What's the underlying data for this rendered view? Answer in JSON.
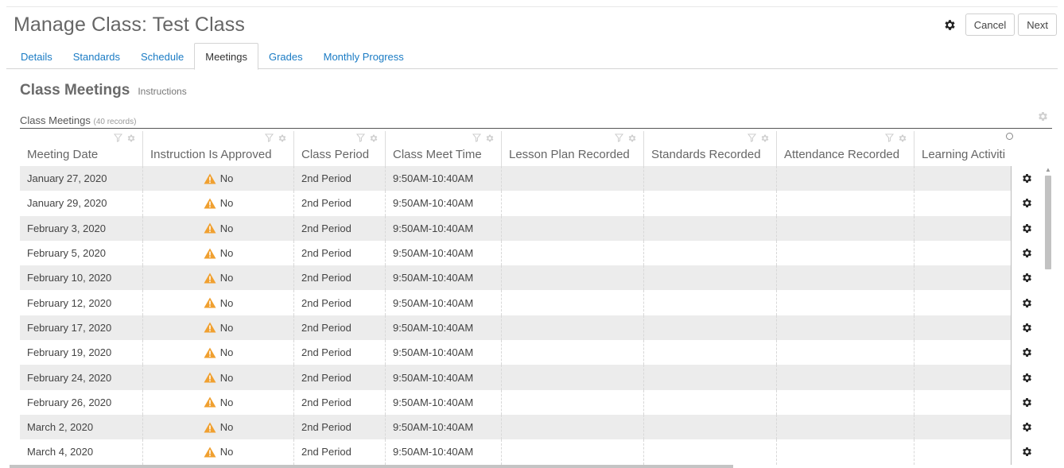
{
  "page_title": "Manage Class: Test Class",
  "actions": {
    "cancel_label": "Cancel",
    "next_label": "Next"
  },
  "tabs": [
    {
      "label": "Details",
      "active": false
    },
    {
      "label": "Standards",
      "active": false
    },
    {
      "label": "Schedule",
      "active": false
    },
    {
      "label": "Meetings",
      "active": true
    },
    {
      "label": "Grades",
      "active": false
    },
    {
      "label": "Monthly Progress",
      "active": false
    }
  ],
  "section": {
    "title": "Class Meetings",
    "instructions": "Instructions"
  },
  "grid": {
    "title": "Class Meetings",
    "count": "(40 records)",
    "columns": [
      {
        "label": "Meeting Date"
      },
      {
        "label": "Instruction Is Approved"
      },
      {
        "label": "Class Period"
      },
      {
        "label": "Class Meet Time"
      },
      {
        "label": "Lesson Plan Recorded"
      },
      {
        "label": "Standards Recorded"
      },
      {
        "label": "Attendance Recorded"
      },
      {
        "label": "Learning Activiti"
      }
    ],
    "rows": [
      {
        "date": "January 27, 2020",
        "approved": "No",
        "period": "2nd Period",
        "time": "9:50AM-10:40AM",
        "lesson": "",
        "standards": "",
        "attendance": "",
        "learning": ""
      },
      {
        "date": "January 29, 2020",
        "approved": "No",
        "period": "2nd Period",
        "time": "9:50AM-10:40AM",
        "lesson": "",
        "standards": "",
        "attendance": "",
        "learning": ""
      },
      {
        "date": "February 3, 2020",
        "approved": "No",
        "period": "2nd Period",
        "time": "9:50AM-10:40AM",
        "lesson": "",
        "standards": "",
        "attendance": "",
        "learning": ""
      },
      {
        "date": "February 5, 2020",
        "approved": "No",
        "period": "2nd Period",
        "time": "9:50AM-10:40AM",
        "lesson": "",
        "standards": "",
        "attendance": "",
        "learning": ""
      },
      {
        "date": "February 10, 2020",
        "approved": "No",
        "period": "2nd Period",
        "time": "9:50AM-10:40AM",
        "lesson": "",
        "standards": "",
        "attendance": "",
        "learning": ""
      },
      {
        "date": "February 12, 2020",
        "approved": "No",
        "period": "2nd Period",
        "time": "9:50AM-10:40AM",
        "lesson": "",
        "standards": "",
        "attendance": "",
        "learning": ""
      },
      {
        "date": "February 17, 2020",
        "approved": "No",
        "period": "2nd Period",
        "time": "9:50AM-10:40AM",
        "lesson": "",
        "standards": "",
        "attendance": "",
        "learning": ""
      },
      {
        "date": "February 19, 2020",
        "approved": "No",
        "period": "2nd Period",
        "time": "9:50AM-10:40AM",
        "lesson": "",
        "standards": "",
        "attendance": "",
        "learning": ""
      },
      {
        "date": "February 24, 2020",
        "approved": "No",
        "period": "2nd Period",
        "time": "9:50AM-10:40AM",
        "lesson": "",
        "standards": "",
        "attendance": "",
        "learning": ""
      },
      {
        "date": "February 26, 2020",
        "approved": "No",
        "period": "2nd Period",
        "time": "9:50AM-10:40AM",
        "lesson": "",
        "standards": "",
        "attendance": "",
        "learning": ""
      },
      {
        "date": "March 2, 2020",
        "approved": "No",
        "period": "2nd Period",
        "time": "9:50AM-10:40AM",
        "lesson": "",
        "standards": "",
        "attendance": "",
        "learning": ""
      },
      {
        "date": "March 4, 2020",
        "approved": "No",
        "period": "2nd Period",
        "time": "9:50AM-10:40AM",
        "lesson": "",
        "standards": "",
        "attendance": "",
        "learning": ""
      }
    ]
  },
  "colors": {
    "link": "#1a7bc4",
    "warning": "#f0a030",
    "row_alt": "#ececec"
  },
  "icons": {
    "gear": "gear-icon",
    "filter": "filter-icon",
    "warning": "warning-icon"
  }
}
